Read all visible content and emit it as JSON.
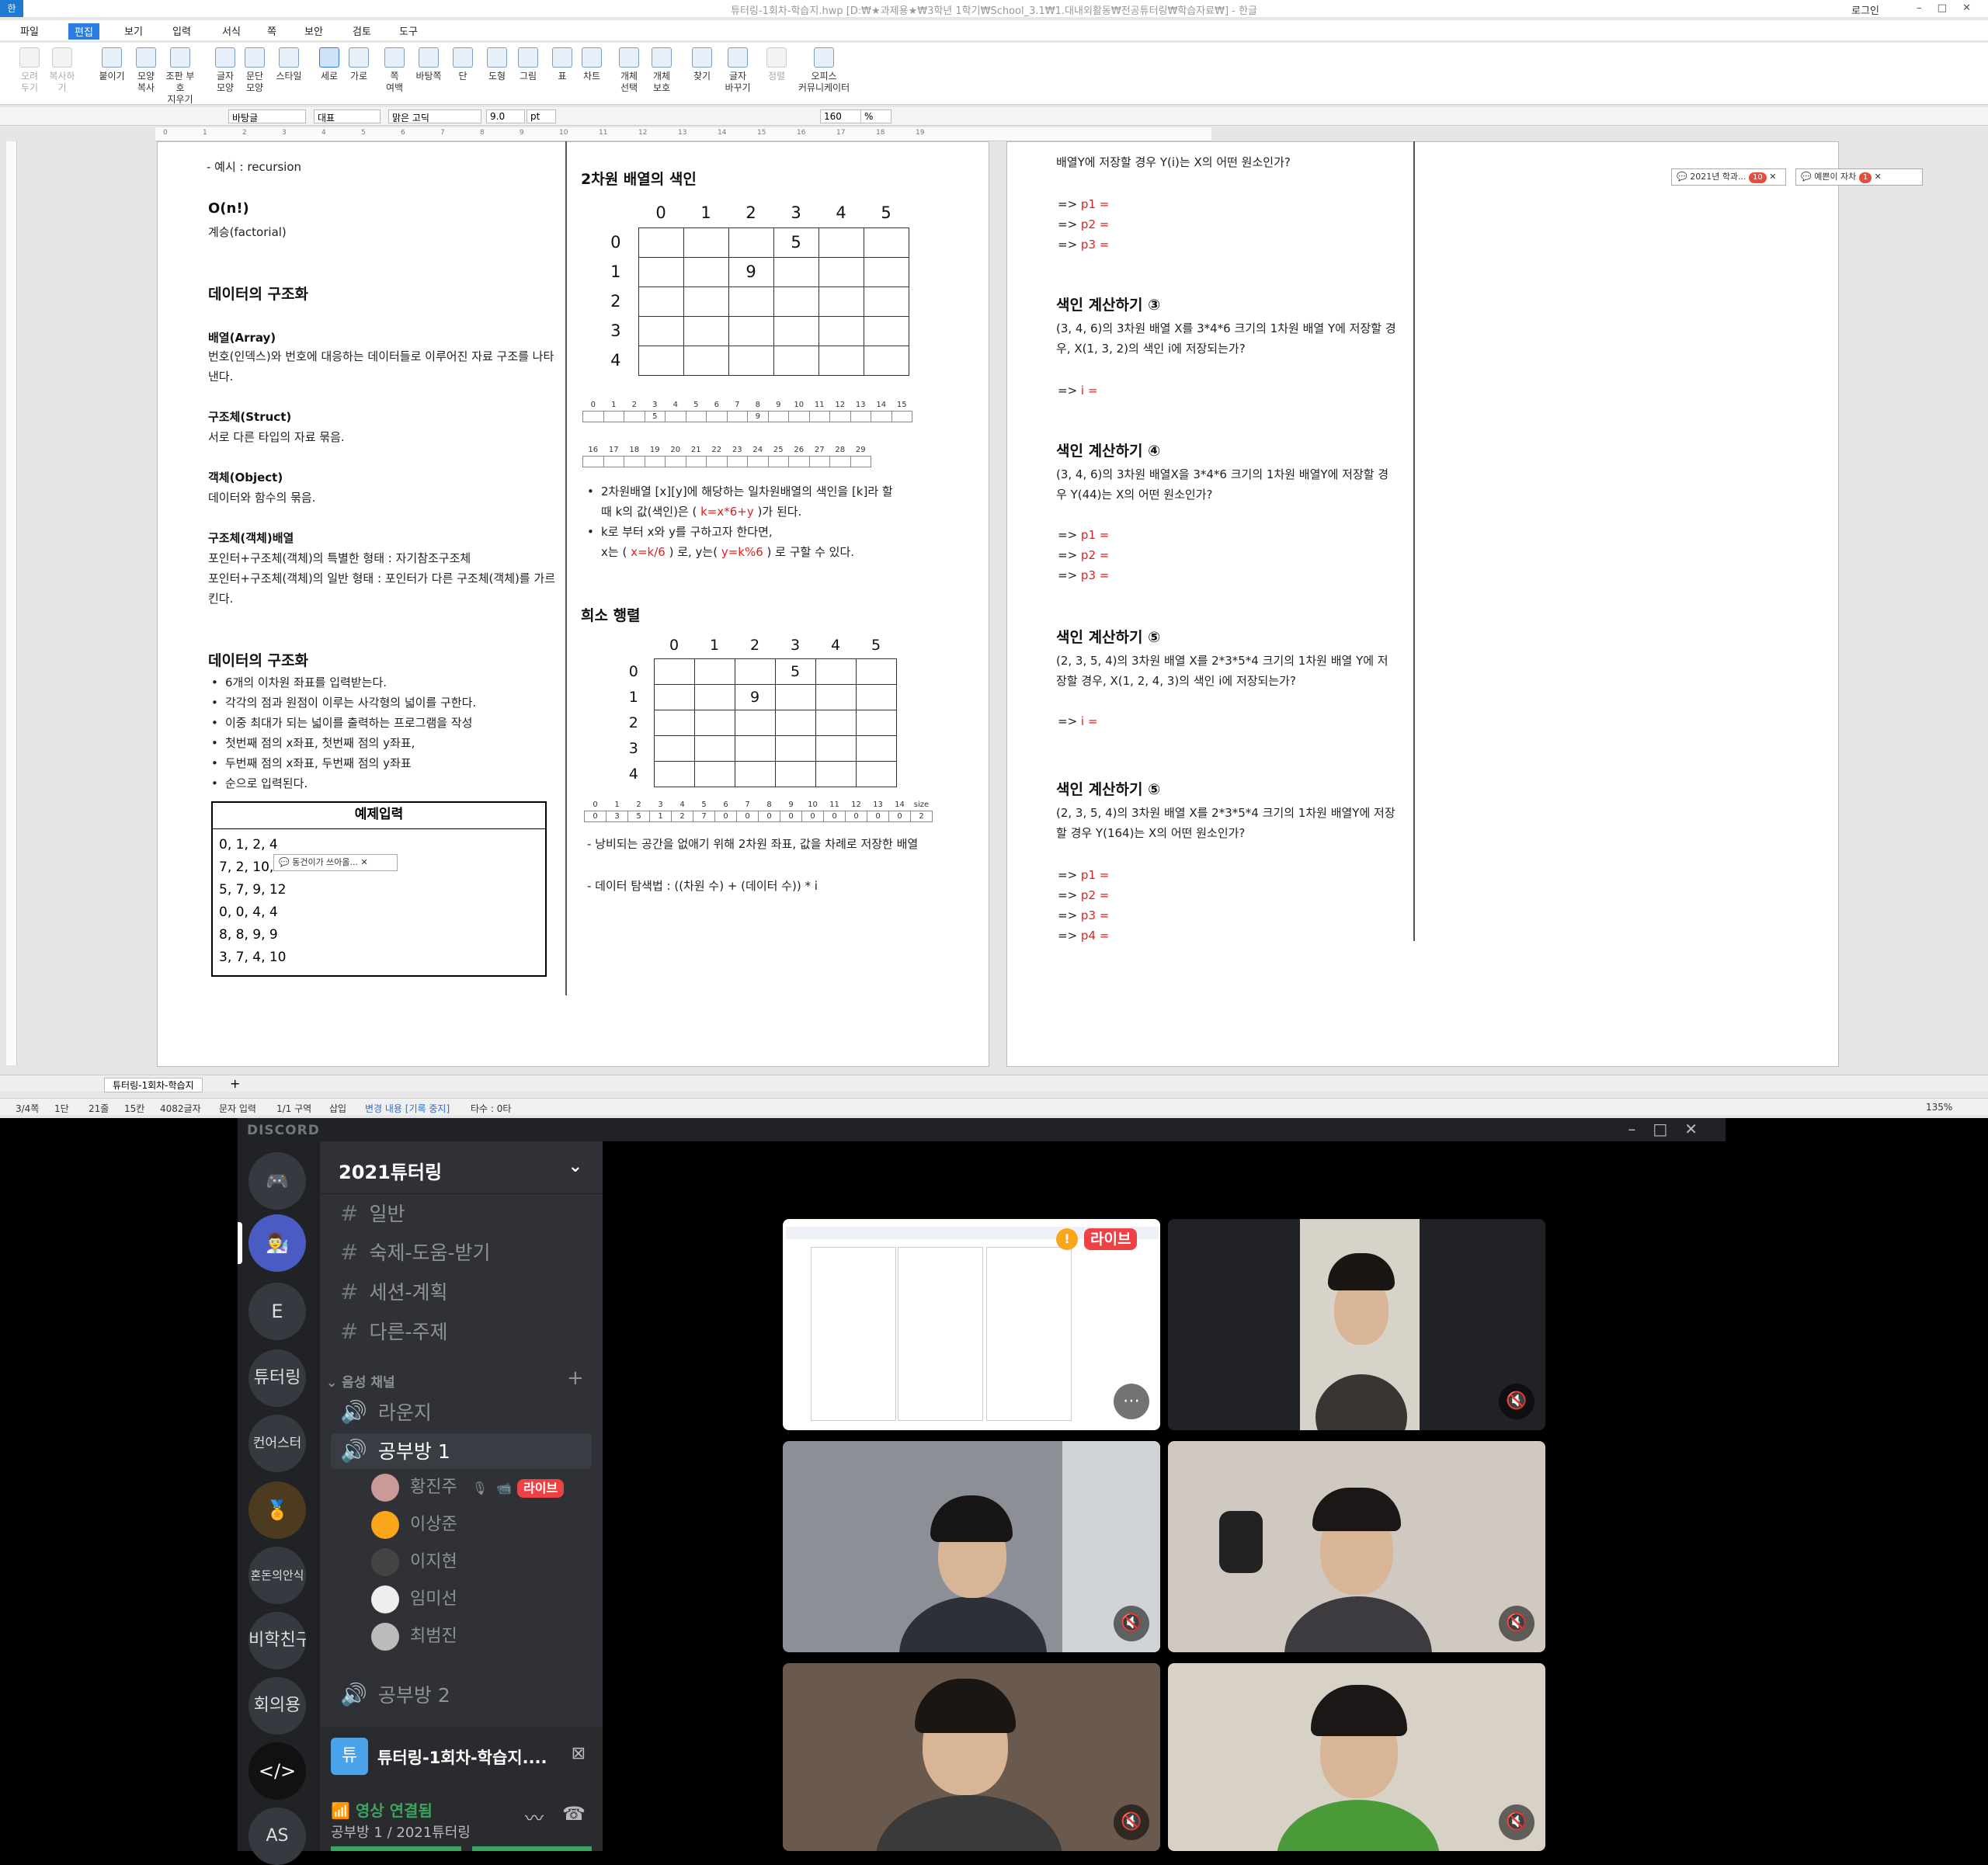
{
  "hwp": {
    "title": "튜터링-1회차-학습지.hwp [D:₩★과제용★₩3학년 1학기₩School_3.1₩1.대내외활동₩전공튜터링₩학습자료₩] - 한글",
    "login": "로그인",
    "menu": [
      "파일",
      "편집",
      "보기",
      "입력",
      "서식",
      "쪽",
      "보안",
      "검토",
      "도구"
    ],
    "ribbon": [
      {
        "label": "오려\n두기",
        "dis": true
      },
      {
        "label": "복사하기",
        "dis": true
      },
      {
        "label": "붙이기"
      },
      {
        "label": "모양\n복사"
      },
      {
        "label": "조판 부호\n지우기"
      },
      {
        "label": "글자\n모양"
      },
      {
        "label": "문단\n모양"
      },
      {
        "label": "스타일"
      },
      {
        "label": "세로",
        "act": true
      },
      {
        "label": "가로"
      },
      {
        "label": "쪽\n여백"
      },
      {
        "label": "바탕쪽"
      },
      {
        "label": "단"
      },
      {
        "label": "도형"
      },
      {
        "label": "그림"
      },
      {
        "label": "표"
      },
      {
        "label": "차트"
      },
      {
        "label": "개체\n선택"
      },
      {
        "label": "개체\n보호"
      },
      {
        "label": "찾기"
      },
      {
        "label": "글자\n바꾸기"
      },
      {
        "label": "정렬",
        "dis": true
      },
      {
        "label": "오피스\n커뮤니케이터"
      }
    ],
    "format": {
      "style": "바탕글",
      "outline": "대표",
      "font": "맑은 고딕",
      "size": "9.0",
      "unit": "pt",
      "zoom": "160",
      "zoom_unit": "%"
    },
    "col1": {
      "top_note": "- 예시 : recursion",
      "on_title": "O(n!)",
      "on_desc": "계승(factorial)",
      "sec1": "데이터의 구조화",
      "array_h": "배열(Array)",
      "array_d": "번호(인덱스)와 번호에 대응하는 데이터들로 이루어진 자료 구조를 나타낸다.",
      "struct_h": "구조체(Struct)",
      "struct_d": "서로 다른 타입의 자료 묶음.",
      "obj_h": "객체(Object)",
      "obj_d": "데이터와 함수의 묶음.",
      "sa_h": "구조체(객체)배열",
      "sa_d1": "포인터+구조체(객체)의 특별한 형태 : 자기참조구조체",
      "sa_d2": "포인터+구조체(객체)의 일반 형태 : 포인터가 다른 구조체(객체)를 가르킨다.",
      "sec2": "데이터의 구조화",
      "bullets": [
        "6개의 이차원 좌표를 입력받는다.",
        "각각의 점과 원점이 이루는 사각형의 넓이를 구한다.",
        "이중 최대가 되는 넓이를 출력하는 프로그램을 작성",
        "첫번째 점의 x좌표, 첫번째 점의 y좌표,",
        "두번째 점의 x좌표, 두번째 점의 y좌표",
        "순으로 입력된다."
      ],
      "example_title": "예제입력",
      "example_lines": [
        "0, 1, 2, 4",
        "7, 2, 10, 5",
        "5, 7, 9, 12",
        "0, 0, 4, 4",
        "8, 8, 9, 9",
        "3, 7, 4, 10"
      ],
      "comment": "동건이가 쓰아올..."
    },
    "col2": {
      "title1": "2차원 배열의 색인",
      "grid_cols": [
        "0",
        "1",
        "2",
        "3",
        "4",
        "5"
      ],
      "grid_rows": [
        "0",
        "1",
        "2",
        "3",
        "4"
      ],
      "cell_0_3": "5",
      "cell_1_2": "9",
      "strip1_idx": [
        "0",
        "1",
        "2",
        "3",
        "4",
        "5",
        "6",
        "7",
        "8",
        "9",
        "10",
        "11",
        "12",
        "13",
        "14",
        "15"
      ],
      "strip1_val5": "5",
      "strip1_val9": "9",
      "strip2_idx": [
        "16",
        "17",
        "18",
        "19",
        "20",
        "21",
        "22",
        "23",
        "24",
        "25",
        "26",
        "27",
        "28",
        "29"
      ],
      "b1a": "2차원배열 [x][y]에 해당하는 일차원배열의 색인을 [k]라 할 때 k의 값(색인)은 ( ",
      "b1r": "k=x*6+y",
      "b1b": " )가 된다.",
      "b2a": "k로 부터 x와 y를 구하고자 한다면,",
      "b2b": "x는 ( ",
      "b2r1": "x=k/6",
      "b2c": " ) 로, y는( ",
      "b2r2": "y=k%6",
      "b2d": " ) 로 구할 수 있다.",
      "title2": "희소 행렬",
      "strip3_idx": [
        "0",
        "1",
        "2",
        "3",
        "4",
        "5",
        "6",
        "7",
        "8",
        "9",
        "10",
        "11",
        "12",
        "13",
        "14",
        "size"
      ],
      "strip3_val": [
        "0",
        "3",
        "5",
        "1",
        "2",
        "7",
        "0",
        "0",
        "0",
        "0",
        "0",
        "0",
        "0",
        "0",
        "0",
        "2"
      ],
      "n1": "- 낭비되는 공간을 없애기 위해 2차원 좌표, 값을 차례로 저장한 배열",
      "n2": "- 데이터 탐색법 : ((차원 수) + (데이터 수)) * i"
    },
    "col3": {
      "top": "배열Y에 저장할 경우 Y(i)는 X의 어떤 원소인가?",
      "p1": "p1 =",
      "p2": "p2 =",
      "p3": "p3 =",
      "p4": "p4 =",
      "i": "i =",
      "arrow": "=>",
      "s3_t": "색인 계산하기 ③",
      "s3_d": "(3, 4, 6)의 3차원 배열 X를 3*4*6 크기의 1차원 배열 Y에 저장할 경우, X(1, 3, 2)의 색인 i에 저장되는가?",
      "s4_t": "색인 계산하기 ④",
      "s4_d": "(3, 4, 6)의 3차원 배열X을 3*4*6 크기의 1차원 배열Y에 저장할 경우 Y(44)는 X의 어떤 원소인가?",
      "s5_t": "색인 계산하기 ⑤",
      "s5_d": "(2, 3, 5, 4)의 3차원 배열 X를 2*3*5*4 크기의 1차원 배열 Y에 저장할 경우, X(1, 2, 4, 3)의 색인 i에 저장되는가?",
      "s6_t": "색인 계산하기 ⑤",
      "s6_d": "(2, 3, 5, 4)의 3차원 배열 X를 2*3*5*4 크기의 1차원 배열Y에 저장할 경우 Y(164)는 X의 어떤 원소인가?",
      "cm1": "2021년 학과...",
      "cm1_badge": "10",
      "cm2": "예쁜이 자차",
      "cm2_badge": "1"
    },
    "tab": "튜터링-1회차-학습지",
    "status": [
      "3/4쪽",
      "1단",
      "21줄",
      "15칸",
      "4082글자",
      "문자 입력",
      "1/1 구역",
      "삽입",
      "변경 내용 [기록 중지]",
      "타수 : 0타",
      "135%"
    ]
  },
  "discord": {
    "wordmark": "DISCORD",
    "server_name": "2021튜터링",
    "guilds": [
      "E",
      "튜터링",
      "컨어스터",
      "혼돈의안식",
      "비학친구",
      "회의용",
      "AS"
    ],
    "text_channels": [
      "일반",
      "숙제-도움-받기",
      "세션-계획",
      "다른-주제"
    ],
    "voice_category": "음성 채널",
    "voice_channels": [
      "라운지",
      "공부방 1",
      "공부방 2"
    ],
    "members": [
      "황진주",
      "이상준",
      "이지현",
      "임미선",
      "최범진"
    ],
    "live": "라이브",
    "stream_title": "튜터링-1회차-학습지....",
    "connected": "영상 연결됨",
    "connected_sub": "공부방 1 / 2021튜터링"
  }
}
